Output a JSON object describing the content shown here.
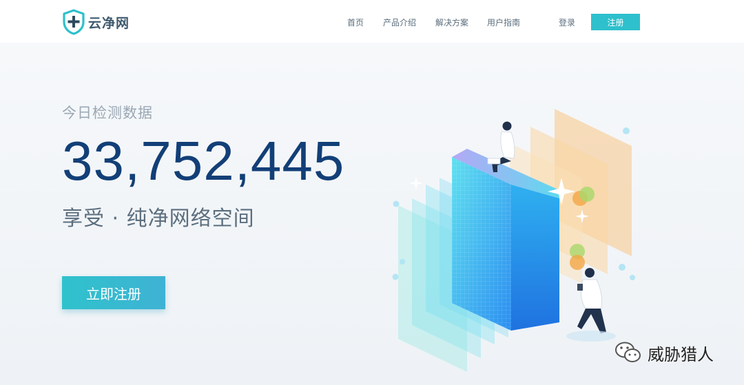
{
  "header": {
    "logo_text": "云净网",
    "nav": [
      {
        "label": "首页"
      },
      {
        "label": "产品介绍"
      },
      {
        "label": "解决方案"
      },
      {
        "label": "用户指南"
      }
    ],
    "login_label": "登录",
    "register_label": "注册"
  },
  "hero": {
    "label": "今日检测数据",
    "count": "33,752,445",
    "slogan": "享受 · 纯净网络空间",
    "cta_label": "立即注册"
  },
  "watermark": {
    "text": "威胁猎人"
  },
  "colors": {
    "brand": "#2ec0cc",
    "count": "#123f77",
    "text_muted": "#9aa7b4",
    "nav_text": "#5b6e7e"
  }
}
